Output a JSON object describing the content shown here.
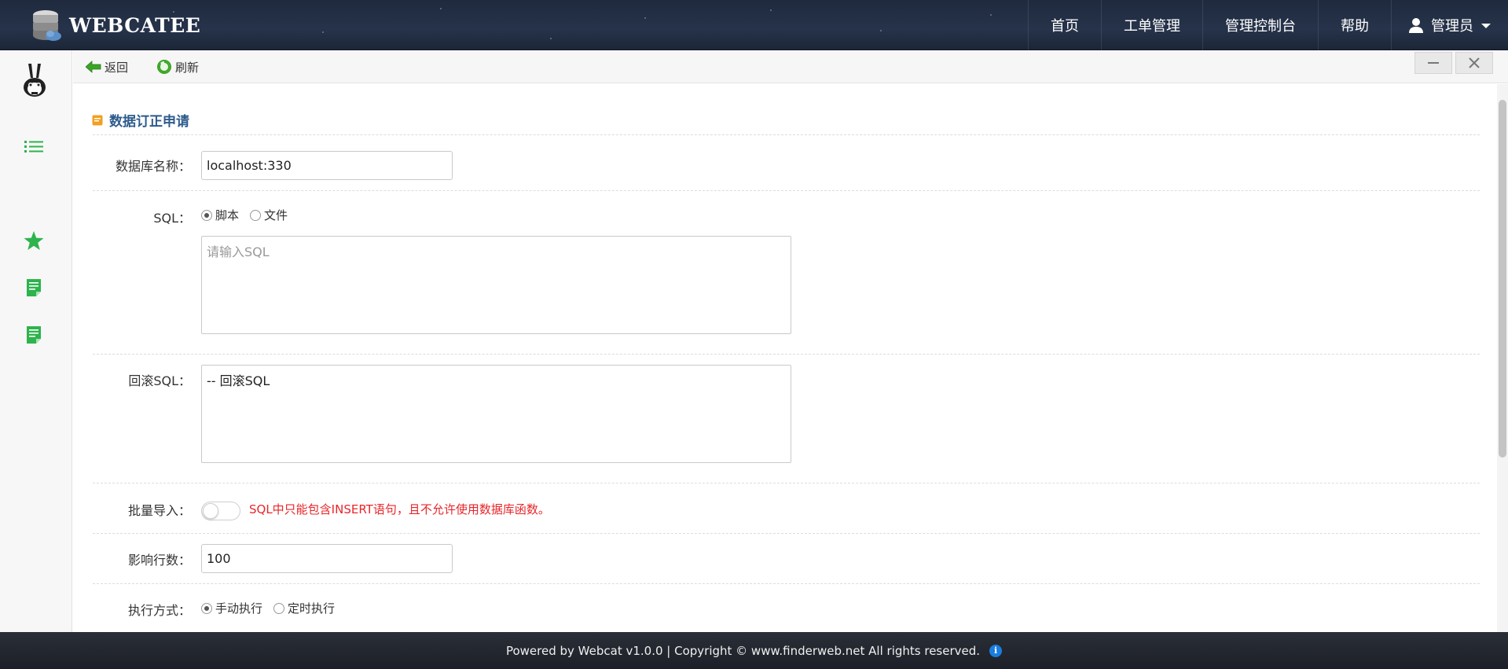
{
  "app": {
    "brand": "WEBCATEE"
  },
  "nav": {
    "items": [
      {
        "label": "首页"
      },
      {
        "label": "工单管理"
      },
      {
        "label": "管理控制台"
      },
      {
        "label": "帮助"
      }
    ],
    "user_label": "管理员"
  },
  "toolbar": {
    "back_label": "返回",
    "refresh_label": "刷新"
  },
  "form": {
    "title": "数据订正申请",
    "db_name": {
      "label": "数据库名称：",
      "value": "localhost:330"
    },
    "sql": {
      "label": "SQL：",
      "options": [
        "脚本",
        "文件"
      ],
      "selected": "脚本",
      "placeholder": "请输入SQL"
    },
    "rollback_sql": {
      "label": "回滚SQL：",
      "value": "-- 回滚SQL"
    },
    "batch_import": {
      "label": "批量导入：",
      "enabled": false,
      "note": "SQL中只能包含INSERT语句，且不允许使用数据库函数。"
    },
    "affected_rows": {
      "label": "影响行数：",
      "value": "100"
    },
    "exec_mode": {
      "label": "执行方式：",
      "options": [
        "手动执行",
        "定时执行"
      ],
      "selected": "手动执行"
    }
  },
  "footer": {
    "text": "Powered by Webcat v1.0.0 | Copyright © www.finderweb.net All rights reserved."
  },
  "colors": {
    "header_bg": "#1f2a3e",
    "accent_green": "#2eb34d",
    "title_blue": "#2d5b8c",
    "warning_red": "#e8262a",
    "title_icon_orange": "#f0a020"
  }
}
